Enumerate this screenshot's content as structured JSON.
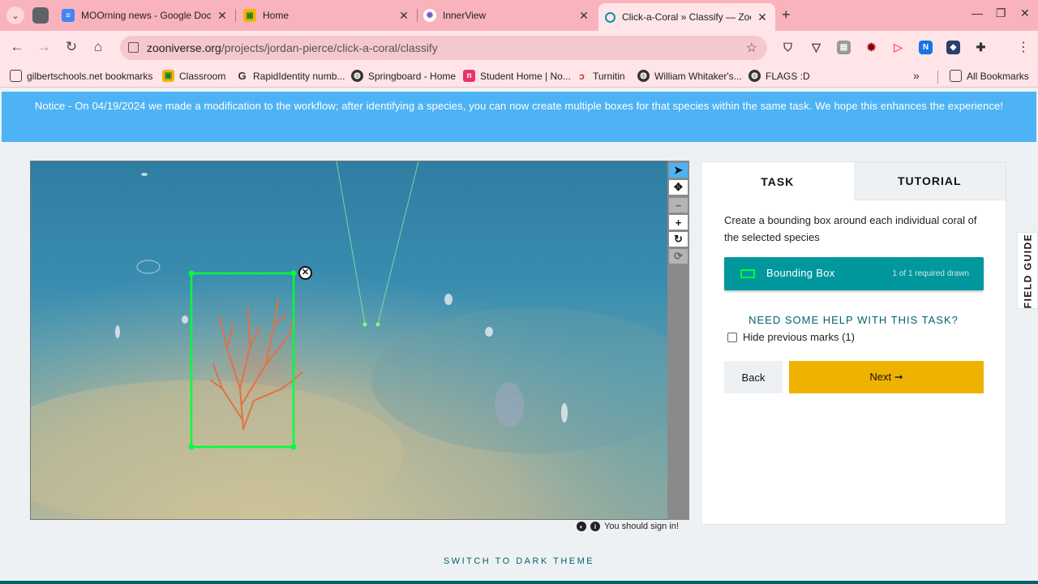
{
  "tabs": [
    {
      "title": "MOOrning news - Google Docs",
      "favicon": "docs-icon",
      "color": "#4285f4"
    },
    {
      "title": "Home",
      "favicon": "classroom-icon",
      "color": "#f4b400"
    },
    {
      "title": "InnerView",
      "favicon": "innerview-icon",
      "color": "#7a5cc7"
    },
    {
      "title": "Click-a-Coral » Classify — Zooni",
      "favicon": "zooniverse-icon",
      "color": "#00979d",
      "active": true
    }
  ],
  "new_tab_glyph": "+",
  "address": {
    "domain": "zooniverse.org",
    "path": "/projects/jordan-pierce/click-a-coral/classify"
  },
  "bookmarks": [
    {
      "label": "gilbertschools.net bookmarks"
    },
    {
      "label": "Classroom"
    },
    {
      "label": "RapidIdentity numb..."
    },
    {
      "label": "Springboard - Home"
    },
    {
      "label": "Student Home | No..."
    },
    {
      "label": "Turnitin"
    },
    {
      "label": "William Whitaker's..."
    },
    {
      "label": "FLAGS :D"
    }
  ],
  "all_bookmarks": "All Bookmarks",
  "notice": "Notice - On 04/19/2024 we made a modification to the workflow; after identifying a species, you can now create multiple boxes for that species within the same task. We hope this enhances the experience!",
  "viewer": {
    "sign_in": "You should sign in!"
  },
  "panel": {
    "tab_task": "TASK",
    "tab_tutorial": "TUTORIAL",
    "instruction": "Create a bounding box around each individual coral of the selected species",
    "tool_label": "Bounding Box",
    "tool_count": "1 of 1 required drawn",
    "help": "NEED SOME HELP WITH THIS TASK?",
    "hide_marks": "Hide previous marks (1)",
    "back": "Back",
    "next": "Next ➞"
  },
  "field_guide": "FIELD GUIDE",
  "theme_toggle": "SWITCH TO DARK THEME",
  "colors": {
    "accent": "#00979d",
    "notice": "#4db3f5",
    "next": "#f0b200",
    "mark": "#00ff3a"
  }
}
